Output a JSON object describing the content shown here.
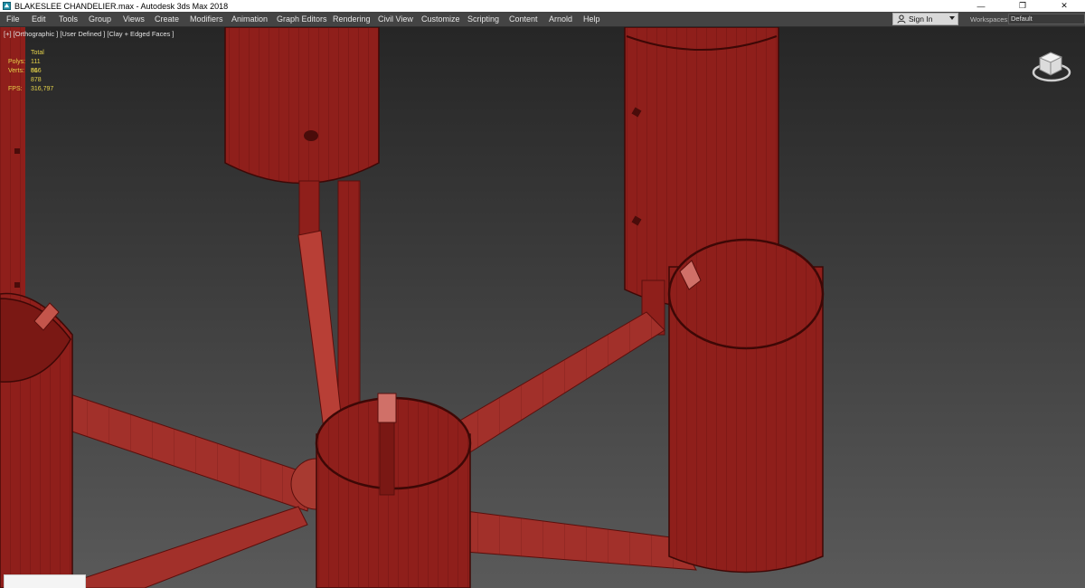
{
  "window": {
    "title": "BLAKESLEE CHANDELIER.max - Autodesk 3ds Max 2018",
    "minimize_glyph": "—",
    "restore_glyph": "❐",
    "close_glyph": "✕"
  },
  "menu": {
    "items": [
      "File",
      "Edit",
      "Tools",
      "Group",
      "Views",
      "Create",
      "Modifiers",
      "Animation",
      "Graph Editors",
      "Rendering",
      "Civil View",
      "Customize",
      "Scripting",
      "Content",
      "Arnold",
      "Help"
    ]
  },
  "account": {
    "sign_in": "Sign In"
  },
  "workspace": {
    "label": "Workspaces:",
    "value": "Default"
  },
  "viewport": {
    "label": "[+] [Orthographic ] [User Defined ] [Clay + Edged Faces ]",
    "stats": {
      "header": "Total",
      "polys_label": "Polys:",
      "polys_value": "111 816",
      "verts_label": "Verts:",
      "verts_value": "56 878",
      "fps_label": "FPS:",
      "fps_value": "316,797"
    }
  },
  "colors": {
    "model_red": "#8f1f1b",
    "model_edge": "#5a0f0c",
    "stats_yellow": "#e6d34a",
    "menu_bg": "#444444"
  },
  "icons": [
    "app-icon",
    "user-icon",
    "viewcube-icon",
    "minimize-icon",
    "restore-icon",
    "close-icon"
  ]
}
